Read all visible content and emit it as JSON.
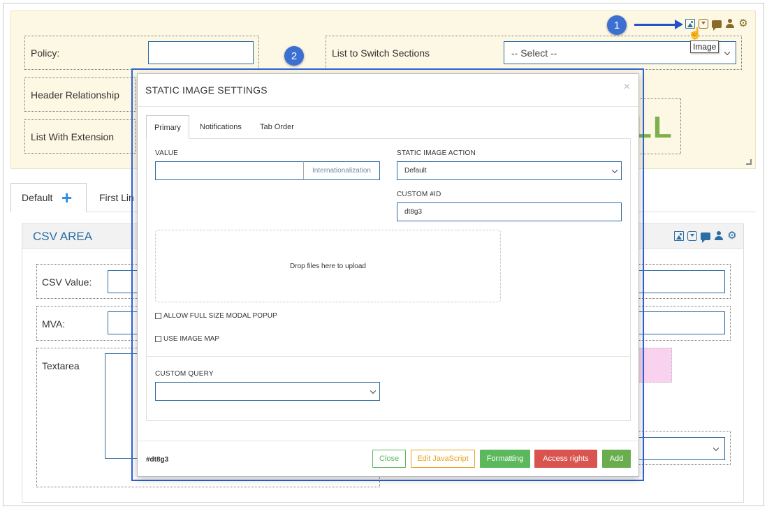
{
  "top_form": {
    "policy_label": "Policy:",
    "header_relationship_label": "Header Relationship",
    "list_with_extension_label": "List With Extension",
    "list_to_switch_label": "List to Switch Sections",
    "select_placeholder": "-- Select --",
    "big_text": "LL"
  },
  "annotations": {
    "badge_1": "1",
    "badge_2": "2",
    "tooltip": "Image"
  },
  "tabs": {
    "default_label": "Default",
    "first_label": "First Lin"
  },
  "csv_area": {
    "title": "CSV AREA",
    "csv_value_label": "CSV Value:",
    "mva_label": "MVA:",
    "textarea_label": "Textarea"
  },
  "modal": {
    "title": "STATIC IMAGE SETTINGS",
    "close_symbol": "×",
    "tabs": [
      "Primary",
      "Notifications",
      "Tab Order"
    ],
    "value_label": "VALUE",
    "value": "",
    "internationalization_label": "Internationalization",
    "static_image_action_label": "STATIC IMAGE ACTION",
    "static_image_action_value": "Default",
    "custom_id_label": "CUSTOM #ID",
    "custom_id_value": "dt8g3",
    "dropzone_text": "Drop files here to upload",
    "allow_full_size_label": "ALLOW FULL SIZE MODAL POPUP",
    "use_image_map_label": "USE IMAGE MAP",
    "custom_query_label": "CUSTOM QUERY",
    "custom_query_value": "",
    "footer_id": "#dt8g3",
    "buttons": {
      "close": "Close",
      "edit_js": "Edit JavaScript",
      "formatting": "Formatting",
      "access_rights": "Access rights",
      "add": "Add"
    }
  },
  "colors": {
    "top_bg": "#fdf8e4",
    "accent_blue": "#2f63d6",
    "success": "#5cb85c",
    "warning": "#e8a317",
    "danger": "#d9534f",
    "icon_brown": "#8a6a2b",
    "icon_blue": "#2a6ea3"
  },
  "icons": [
    "image-icon",
    "dropdown-icon",
    "comment-icon",
    "user-icon",
    "gear-icon"
  ]
}
